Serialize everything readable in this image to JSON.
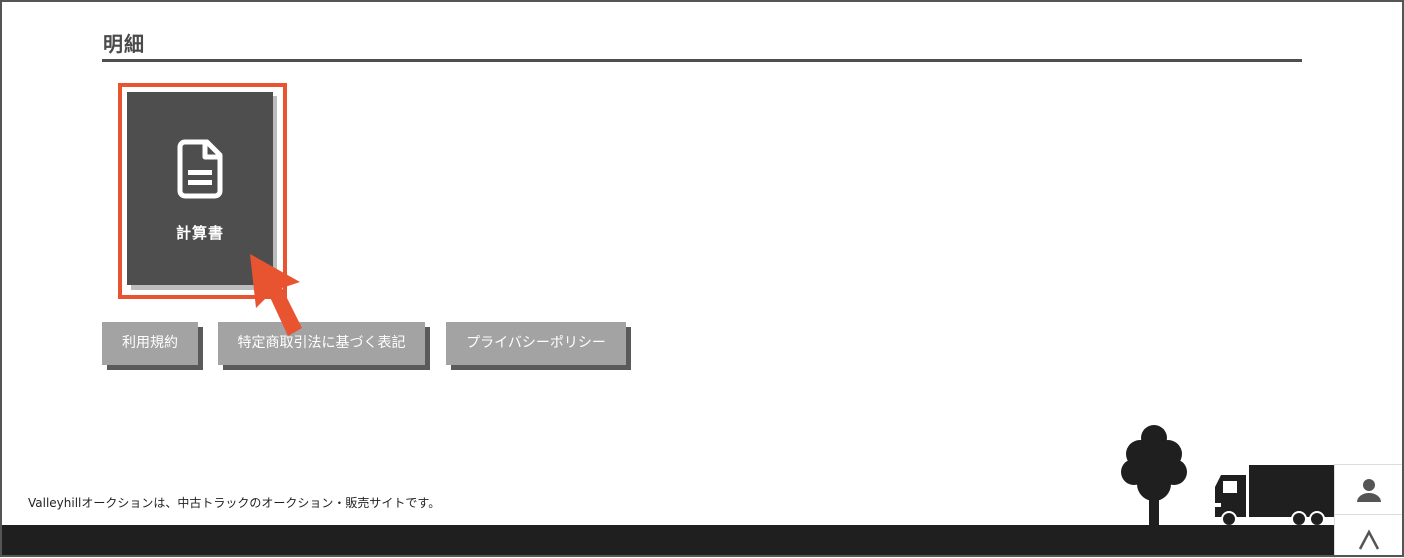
{
  "section": {
    "title": "明細"
  },
  "document_card": {
    "label": "計算書",
    "icon": "document-icon"
  },
  "footer_links": {
    "terms": "利用規約",
    "commerce": "特定商取引法に基づく表記",
    "privacy": "プライバシーポリシー"
  },
  "footer": {
    "tagline": "Valleyhillオークションは、中古トラックのオークション・販売サイトです。"
  },
  "side_buttons": {
    "user_icon": "user-icon",
    "top_icon": "chevron-up-icon"
  },
  "colors": {
    "accent": "#e85330",
    "card_bg": "#4e4e4e",
    "link_bg": "#a3a3a3",
    "ground": "#1f1f1f"
  }
}
